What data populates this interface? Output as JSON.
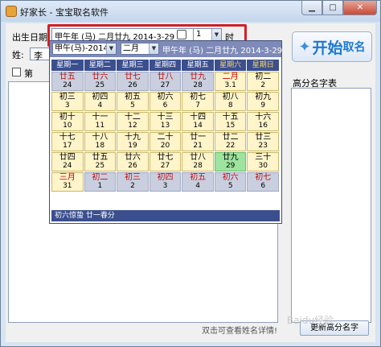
{
  "window": {
    "title": "好家长 - 宝宝取名软件"
  },
  "form": {
    "birth_label": "出生日期",
    "date_value": "甲午年 (马) 二月廿九  2014-3-29",
    "hour_value": "1",
    "hour_unit": "时",
    "surname_label": "姓:",
    "surname_value": "李",
    "checkbox_label": "第"
  },
  "actions": {
    "start_main": "开始",
    "start_sub": "取名",
    "list_label": "高分名字表",
    "hint": "双击可查看姓名详情!",
    "detail_button": "更新高分名字",
    "watermark": "Baidu经验"
  },
  "calendar": {
    "year_select": "甲午(马)-2014",
    "month_select": "二月",
    "header_text": "甲午年 (马) 二月廿九  2014-3-29",
    "weekdays": [
      "星期一",
      "星期二",
      "星期三",
      "星期四",
      "星期五",
      "星期六",
      "星期日"
    ],
    "weeks": [
      [
        {
          "l": "廿五",
          "s": "24",
          "o": true
        },
        {
          "l": "廿六",
          "s": "25",
          "o": true
        },
        {
          "l": "廿七",
          "s": "26",
          "o": true
        },
        {
          "l": "廿八",
          "s": "27",
          "o": true
        },
        {
          "l": "廿九",
          "s": "28",
          "o": true
        },
        {
          "l": "二月",
          "s": "3.1",
          "r": true
        },
        {
          "l": "初二",
          "s": "2"
        }
      ],
      [
        {
          "l": "初三",
          "s": "3"
        },
        {
          "l": "初四",
          "s": "4"
        },
        {
          "l": "初五",
          "s": "5"
        },
        {
          "l": "初六",
          "s": "6"
        },
        {
          "l": "初七",
          "s": "7"
        },
        {
          "l": "初八",
          "s": "8"
        },
        {
          "l": "初九",
          "s": "9"
        }
      ],
      [
        {
          "l": "初十",
          "s": "10"
        },
        {
          "l": "十一",
          "s": "11"
        },
        {
          "l": "十二",
          "s": "12"
        },
        {
          "l": "十三",
          "s": "13"
        },
        {
          "l": "十四",
          "s": "14"
        },
        {
          "l": "十五",
          "s": "15"
        },
        {
          "l": "十六",
          "s": "16"
        }
      ],
      [
        {
          "l": "十七",
          "s": "17"
        },
        {
          "l": "十八",
          "s": "18"
        },
        {
          "l": "十九",
          "s": "19"
        },
        {
          "l": "二十",
          "s": "20"
        },
        {
          "l": "廿一",
          "s": "21"
        },
        {
          "l": "廿二",
          "s": "22"
        },
        {
          "l": "廿三",
          "s": "23"
        }
      ],
      [
        {
          "l": "廿四",
          "s": "24"
        },
        {
          "l": "廿五",
          "s": "25"
        },
        {
          "l": "廿六",
          "s": "26"
        },
        {
          "l": "廿七",
          "s": "27"
        },
        {
          "l": "廿八",
          "s": "28"
        },
        {
          "l": "廿九",
          "s": "29",
          "t": true
        },
        {
          "l": "三十",
          "s": "30"
        }
      ],
      [
        {
          "l": "三月",
          "s": "31",
          "r": true
        },
        {
          "l": "初二",
          "s": "1",
          "o": true
        },
        {
          "l": "初三",
          "s": "2",
          "o": true
        },
        {
          "l": "初四",
          "s": "3",
          "o": true
        },
        {
          "l": "初五",
          "s": "4",
          "o": true
        },
        {
          "l": "初六",
          "s": "5",
          "o": true
        },
        {
          "l": "初七",
          "s": "6",
          "o": true
        }
      ]
    ],
    "footer": "初六惊蛰  廿一春分"
  }
}
